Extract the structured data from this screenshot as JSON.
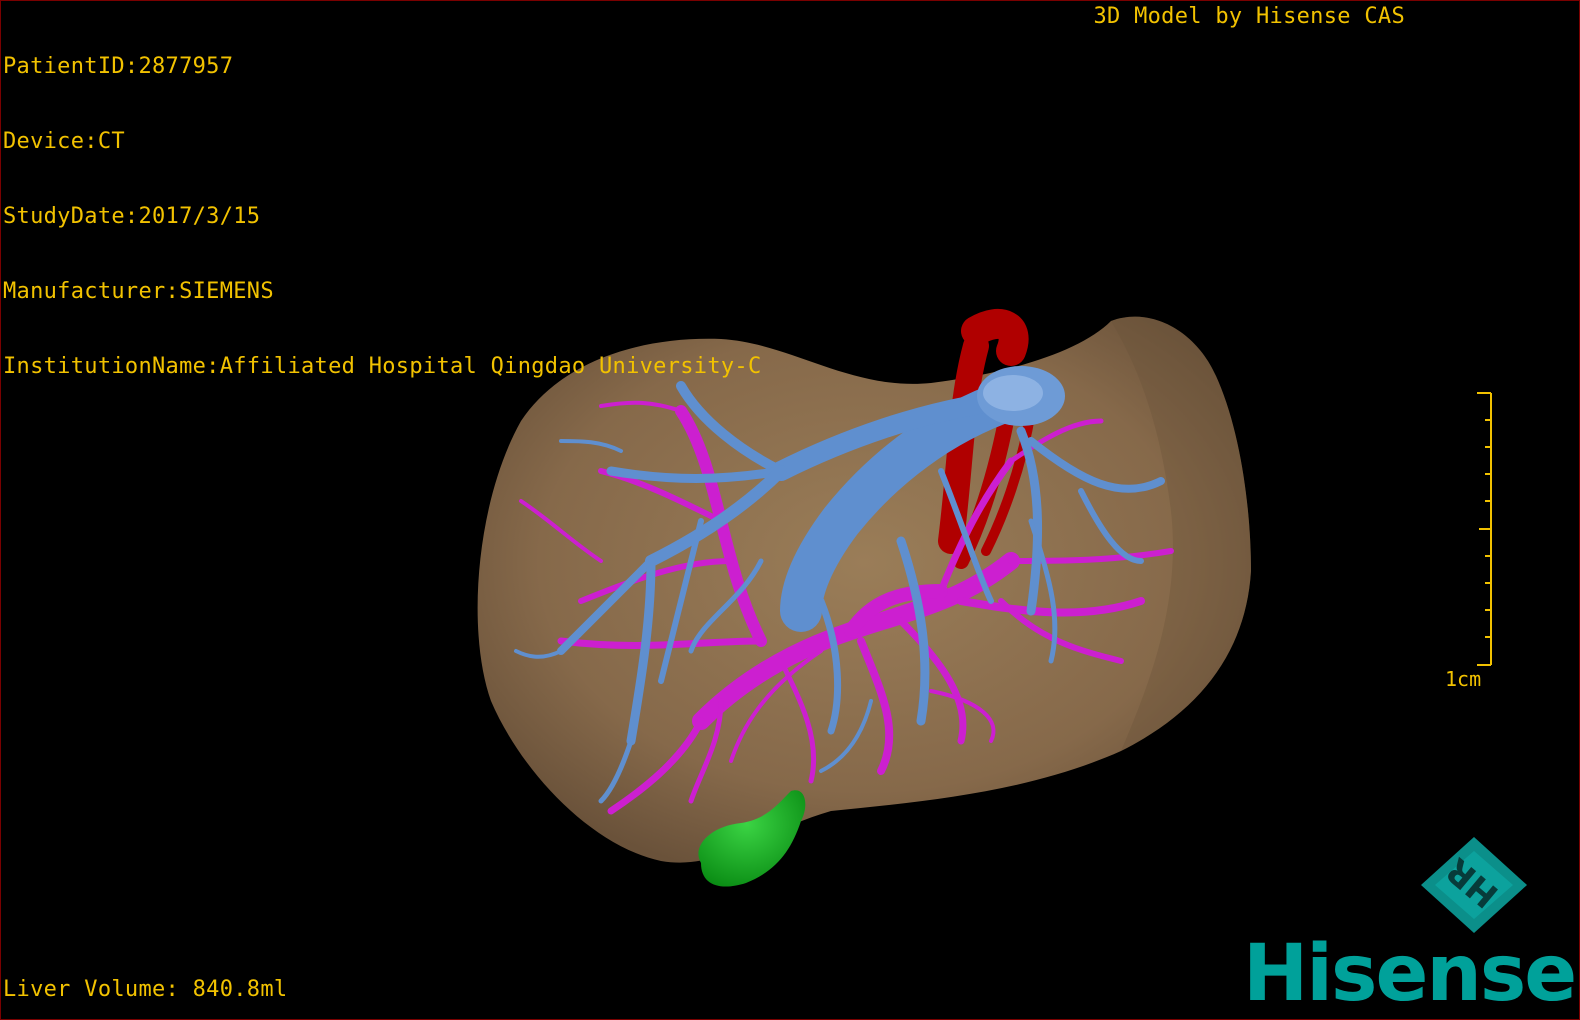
{
  "overlay": {
    "patient_id": "PatientID:2877957",
    "device": "Device:CT",
    "study_date": "StudyDate:2017/3/15",
    "manufacturer": "Manufacturer:SIEMENS",
    "institution": "InstitutionName:Affiliated Hospital Qingdao University-C",
    "model_credit": "3D Model by Hisense CAS",
    "liver_volume": "Liver Volume: 840.8ml"
  },
  "scale": {
    "label": "1cm"
  },
  "logo": {
    "brand": "Hisense",
    "badge": "HR"
  },
  "colors": {
    "overlay_text": "#f2c200",
    "liver": "#8a6f4e",
    "portal_vein": "#5f8fcf",
    "hepatic_vein": "#cc1fd0",
    "artery": "#b00000",
    "gallbladder": "#0fa81a",
    "brand": "#00a19a"
  },
  "model_parts": [
    "liver",
    "portal-vein",
    "hepatic-vein",
    "artery",
    "gallbladder"
  ]
}
